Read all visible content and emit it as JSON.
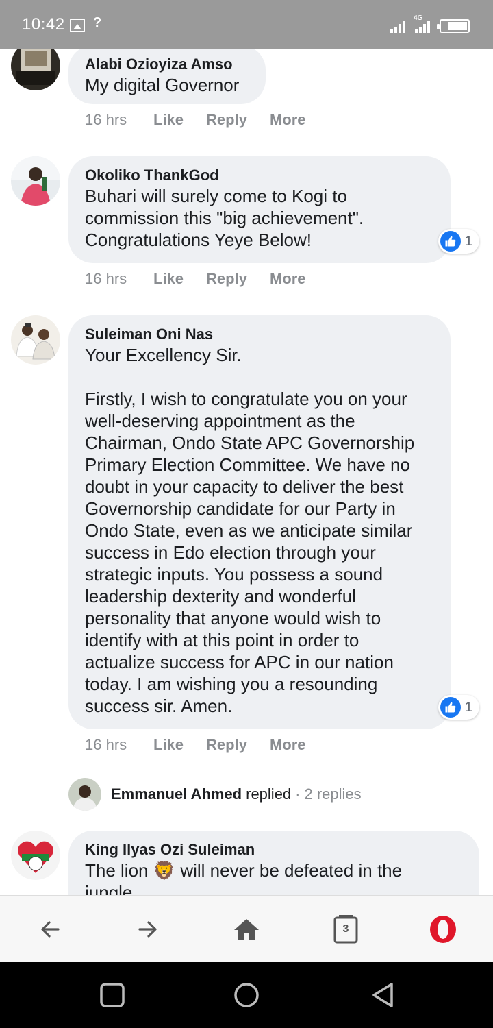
{
  "status_bar": {
    "time": "10:42",
    "network_label": "4G",
    "icons": [
      "image-icon",
      "no-signal-icon",
      "signal-icon",
      "signal-4g-icon",
      "battery-icon"
    ]
  },
  "comments": [
    {
      "author": "Alabi Ozioyiza Amso",
      "text": "My digital Governor",
      "time": "16 hrs",
      "actions": [
        "Like",
        "Reply",
        "More"
      ]
    },
    {
      "author": "Okoliko ThankGod",
      "text": "Buhari will surely come to Kogi to\ncommission this \"big achievement\".\nCongratulations Yeye Below!",
      "time": "16 hrs",
      "actions": [
        "Like",
        "Reply",
        "More"
      ],
      "reactions": "1"
    },
    {
      "author": "Suleiman Oni Nas",
      "text": "Your Excellency Sir.\n\nFirstly, I wish to congratulate you on your\nwell-deserving appointment as the\nChairman, Ondo State APC Governorship\nPrimary Election Committee. We have no\ndoubt in your capacity to deliver the best\nGovernorship candidate for our Party in\nOndo State, even as we anticipate similar\nsuccess in Edo election through your\nstrategic inputs. You possess a sound\nleadership dexterity and wonderful\npersonality that anyone would wish to\nidentify with at this point in order to\nactualize success for APC in our nation\ntoday. I am wishing you a resounding\nsuccess sir. Amen.",
      "time": "16 hrs",
      "actions": [
        "Like",
        "Reply",
        "More"
      ],
      "reactions": "1"
    },
    {
      "author": "King Ilyas Ozi Suleiman",
      "text": "The lion 🦁 will never be defeated in the\njungle"
    }
  ],
  "reply_summary": {
    "name": "Emmanuel Ahmed",
    "verb": "replied",
    "separator": "·",
    "count": "2 replies"
  },
  "browser_bar": {
    "tabs_count": "3",
    "buttons": [
      "back-arrow-icon",
      "forward-arrow-icon",
      "home-icon",
      "tabs-icon",
      "opera-logo-icon"
    ]
  },
  "system_nav": [
    "recent-apps-icon",
    "home-circle-icon",
    "back-triangle-icon"
  ],
  "colors": {
    "status_bar": "#9a9a9a",
    "bubble": "#eef0f3",
    "like_blue": "#1877f2",
    "muted_text": "#8a8d91",
    "opera_red": "#e0172a"
  }
}
